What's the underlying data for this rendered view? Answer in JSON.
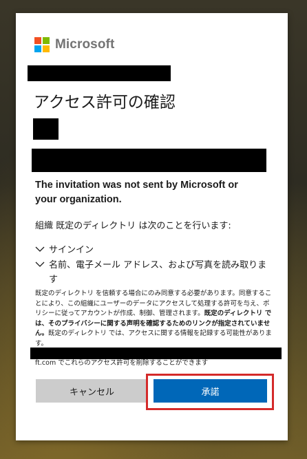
{
  "brand": {
    "name": "Microsoft",
    "colors": [
      "#f25022",
      "#7fba00",
      "#00a4ef",
      "#ffb900"
    ]
  },
  "title": "アクセス許可の確認",
  "warning": "The invitation was not sent by Microsoft or your organization.",
  "org_line": "組織 既定のディレクトリ は次のことを行います:",
  "permissions": [
    {
      "icon": "chevron-down-icon",
      "label": "サインイン"
    },
    {
      "icon": "chevron-down-icon",
      "label": "名前、電子メール アドレス、および写真を読み取ります"
    }
  ],
  "disclaimer": {
    "part1": "既定のディレクトリ を信頼する場合にのみ同意する必要があります。同意することにより、この組織にユーザーのデータにアクセスして処理する許可を与え、ポリシーに従ってアカウントが作成、制御、管理されます。",
    "bold": "既定のディレクトリ では、そのプライバシーに関する声明を確認するためのリンクが指定されていません。",
    "part2": "既定のディレクトリ では、アクセスに関する情報を記録する可能性があります。"
  },
  "manage_line": "ft.com でこれらのアクセス許可を削除することができます",
  "buttons": {
    "cancel": "キャンセル",
    "accept": "承諾"
  },
  "colors": {
    "accent": "#0067b8",
    "highlight": "#d42a2a",
    "cancel_bg": "#cccccc"
  }
}
